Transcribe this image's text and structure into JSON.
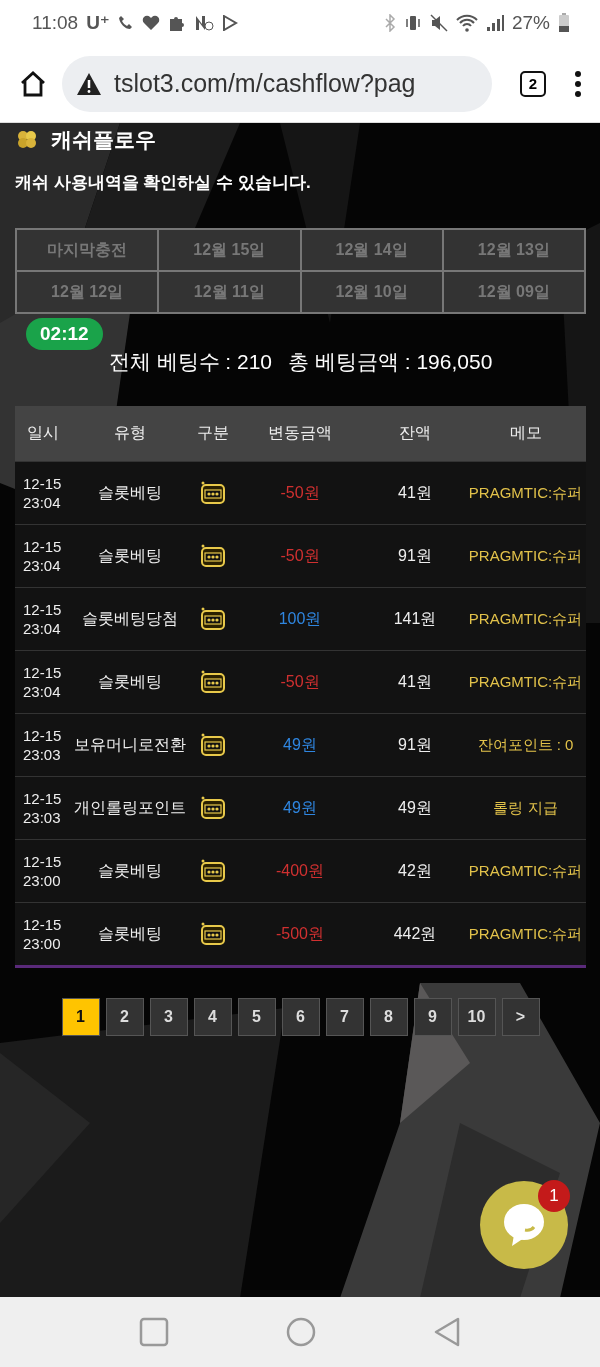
{
  "status_bar": {
    "time": "11:08",
    "carrier": "U⁺",
    "battery": "27%"
  },
  "browser": {
    "url": "tslot3.com/m/cashflow?pag",
    "tab_count": "2"
  },
  "page": {
    "title": "캐쉬플로우",
    "subtitle": "캐쉬 사용내역을 확인하실 수 있습니다."
  },
  "date_filters": [
    "마지막충전",
    "12월 15일",
    "12월 14일",
    "12월 13일",
    "12월 12일",
    "12월 11일",
    "12월 10일",
    "12월 09일"
  ],
  "timer": "02:12",
  "totals": {
    "count": "전체 베팅수 : 210",
    "amount": "총 베팅금액 : 196,050"
  },
  "table": {
    "columns": [
      "일시",
      "유형",
      "구분",
      "변동금액",
      "잔액",
      "메모"
    ],
    "rows": [
      {
        "date": "12-15",
        "time": "23:04",
        "type": "슬롯베팅",
        "amount": "-50원",
        "kind": "debit",
        "balance": "41원",
        "memo": "PRAGMTIC:슈퍼"
      },
      {
        "date": "12-15",
        "time": "23:04",
        "type": "슬롯베팅",
        "amount": "-50원",
        "kind": "debit",
        "balance": "91원",
        "memo": "PRAGMTIC:슈퍼"
      },
      {
        "date": "12-15",
        "time": "23:04",
        "type": "슬롯베팅당첨",
        "amount": "100원",
        "kind": "credit",
        "balance": "141원",
        "memo": "PRAGMTIC:슈퍼"
      },
      {
        "date": "12-15",
        "time": "23:04",
        "type": "슬롯베팅",
        "amount": "-50원",
        "kind": "debit",
        "balance": "41원",
        "memo": "PRAGMTIC:슈퍼"
      },
      {
        "date": "12-15",
        "time": "23:03",
        "type": "보유머니로전환",
        "amount": "49원",
        "kind": "credit",
        "balance": "91원",
        "memo": "잔여포인트 : 0"
      },
      {
        "date": "12-15",
        "time": "23:03",
        "type": "개인롤링포인트",
        "amount": "49원",
        "kind": "credit",
        "balance": "49원",
        "memo": "롤링 지급"
      },
      {
        "date": "12-15",
        "time": "23:00",
        "type": "슬롯베팅",
        "amount": "-400원",
        "kind": "debit",
        "balance": "42원",
        "memo": "PRAGMTIC:슈퍼"
      },
      {
        "date": "12-15",
        "time": "23:00",
        "type": "슬롯베팅",
        "amount": "-500원",
        "kind": "debit",
        "balance": "442원",
        "memo": "PRAGMTIC:슈퍼"
      }
    ]
  },
  "pagination": [
    {
      "label": "1",
      "selected": true
    },
    {
      "label": "2",
      "selected": false
    },
    {
      "label": "3",
      "selected": false
    },
    {
      "label": "4",
      "selected": false
    },
    {
      "label": "5",
      "selected": false
    },
    {
      "label": "6",
      "selected": false
    },
    {
      "label": "7",
      "selected": false
    },
    {
      "label": "8",
      "selected": false
    },
    {
      "label": "9",
      "selected": false
    },
    {
      "label": "10",
      "selected": false
    },
    {
      "label": ">",
      "selected": false
    }
  ],
  "chat": {
    "badge": "1"
  }
}
